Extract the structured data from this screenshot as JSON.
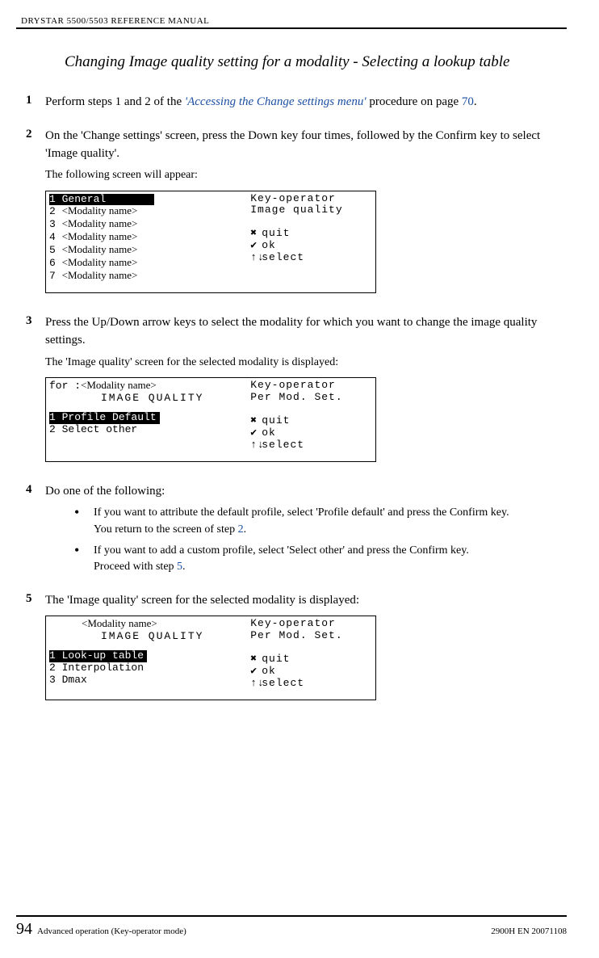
{
  "header": "DRYSTAR 5500/5503 REFERENCE MANUAL",
  "title": "Changing Image quality setting for a modality - Selecting a lookup table",
  "steps": {
    "s1": {
      "num": "1",
      "pre": "Perform steps 1 and 2 of the ",
      "link": "'Accessing the Change settings menu'",
      "mid": " procedure on page ",
      "page": "70",
      "post": "."
    },
    "s2": {
      "num": "2",
      "text": "On the 'Change settings' screen, press the Down key four times, followed by the Confirm key to select 'Image quality'.",
      "sub": "The following screen will appear:"
    },
    "s3": {
      "num": "3",
      "text": "Press the Up/Down arrow keys to select the modality for which you want to change the image quality settings.",
      "sub": "The 'Image quality' screen for the selected modality is displayed:"
    },
    "s4": {
      "num": "4",
      "text": "Do one of the following:",
      "b1a": "If you want to attribute the default profile, select 'Profile default' and press the Confirm key.",
      "b1b_pre": "You return to the screen of step ",
      "b1b_link": "2",
      "b1b_post": ".",
      "b2a": "If you want to add a custom profile, select 'Select other' and press the Confirm key.",
      "b2b_pre": "Proceed with step ",
      "b2b_link": "5",
      "b2b_post": "."
    },
    "s5": {
      "num": "5",
      "text": "The 'Image quality' screen for the selected modality is displayed:"
    }
  },
  "screen1": {
    "r1": "1 General",
    "r2p": "2 ",
    "r2m": "<Modality name>",
    "r3p": "3 ",
    "r3m": "<Modality name>",
    "r4p": "4 ",
    "r4m": "<Modality name>",
    "r5p": "5 ",
    "r5m": "<Modality name>",
    "r6p": "6 ",
    "r6m": "<Modality name>",
    "r7p": "7 ",
    "r7m": "<Modality name>",
    "right1": "Key-operator",
    "right2": "Image quality",
    "opt1": "quit",
    "opt2": "ok",
    "opt3": "select"
  },
  "screen2": {
    "r0p": "for :",
    "r0m": "<Modality name>",
    "r0t": "IMAGE QUALITY",
    "r1": "1 Profile Default",
    "r2": "2 Select other",
    "right1": "Key-operator",
    "right2": "Per Mod. Set.",
    "opt1": "quit",
    "opt2": "ok",
    "opt3": "select"
  },
  "screen3": {
    "r0m": "<Modality name>",
    "r0t": "IMAGE QUALITY",
    "r1": "1 Look-up table",
    "r2": "2 Interpolation",
    "r3": "3 Dmax",
    "right1": "Key-operator",
    "right2": "Per Mod. Set.",
    "opt1": "quit",
    "opt2": "ok",
    "opt3": "select"
  },
  "footer": {
    "num": "94",
    "left": "Advanced operation (Key-operator mode)",
    "right": "2900H EN 20071108"
  },
  "sym": {
    "x": "✖",
    "check": "✔",
    "arrows": "↑↓"
  }
}
